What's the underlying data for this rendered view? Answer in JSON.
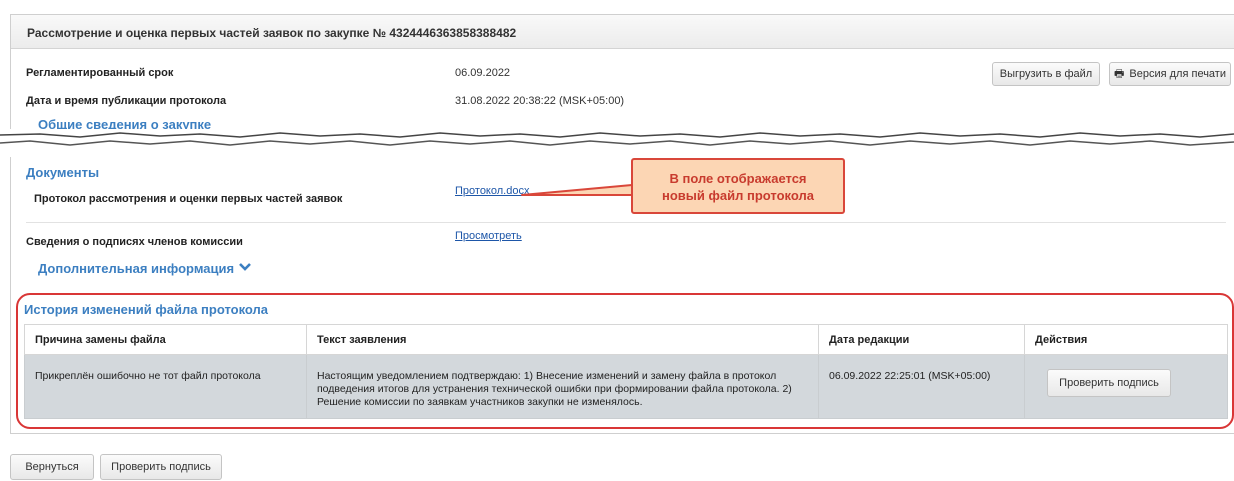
{
  "header": {
    "title": "Рассмотрение и оценка первых частей заявок по закупке № 4324446363858388482"
  },
  "fields": {
    "deadline_label": "Регламентированный срок",
    "deadline_value": "06.09.2022",
    "published_label": "Дата и время публикации протокола",
    "published_value": "31.08.2022 20:38:22 (MSK+05:00)"
  },
  "toolbar": {
    "export_label": "Выгрузить в файл",
    "print_label": "Версия для печати",
    "print_icon": "printer-icon"
  },
  "sections": {
    "general": "Общие сведения о закупке",
    "documents": "Документы",
    "additional": "Дополнительная информация",
    "additional_icon": "chevron-down-icon"
  },
  "documents": {
    "protocol_label": "Протокол рассмотрения и оценки первых частей заявок",
    "protocol_link": "Протокол.docx",
    "signatures_label": "Сведения о подписях членов комиссии",
    "signatures_link": "Просмотреть"
  },
  "callout": {
    "line1": "В поле отображается",
    "line2": "новый файл протокола"
  },
  "history": {
    "title": "История изменений файла протокола",
    "columns": [
      "Причина замены файла",
      "Текст заявления",
      "Дата редакции",
      "Действия"
    ],
    "rows": [
      {
        "reason": "Прикреплён ошибочно не тот файл протокола",
        "text": "Настоящим уведомлением подтверждаю: 1) Внесение изменений и замену файла в протокол подведения итогов для устранения технической ошибки при формировании файла протокола. 2) Решение комиссии по заявкам участников закупки не изменялось.",
        "date": "06.09.2022 22:25:01 (MSK+05:00)",
        "action": "Проверить подпись"
      }
    ]
  },
  "footer": {
    "back_label": "Вернуться",
    "check_label": "Проверить подпись"
  },
  "colors": {
    "section_title": "#3c7fc1",
    "link": "#1d56a8",
    "callout_bg": "#fcd6b4",
    "callout_border": "#d9473a",
    "highlight_frame": "#d93636",
    "row_bg": "#d3d8dc"
  }
}
